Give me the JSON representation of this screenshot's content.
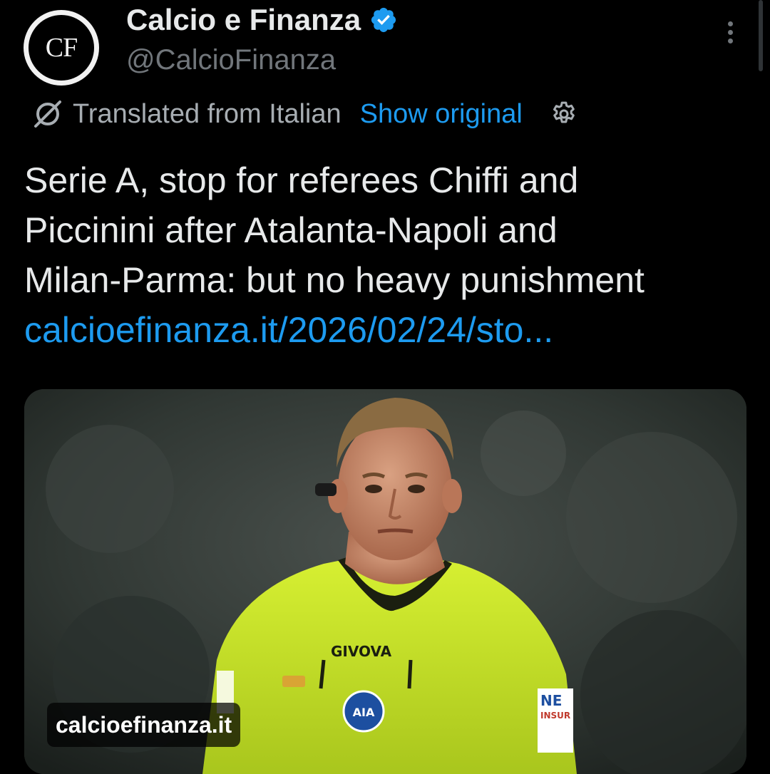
{
  "account": {
    "display_name": "Calcio e Finanza",
    "handle": "@CalcioFinanza",
    "avatar_initials": "CF",
    "verified_icon": "verified-badge-icon"
  },
  "translation": {
    "icon": "translate-icon",
    "label": "Translated from Italian",
    "show_original": "Show original",
    "settings_icon": "gear-icon"
  },
  "post": {
    "text": "Serie A, stop for referees Chiffi and\nPiccinini after Atalanta-Napoli and\nMilan-Parma: but no heavy punishment\n",
    "link": "calcioefinanza.it/2026/02/24/sto..."
  },
  "media": {
    "domain_label": "calcioefinanza.it",
    "shirt_brand": "GIVOVA",
    "badge_text": "AIA",
    "sleeve_text_1": "NE",
    "sleeve_text_2": "INSUR"
  },
  "colors": {
    "background": "#000000",
    "text_primary": "#e7e9ea",
    "text_secondary": "#71767b",
    "link": "#1d9bf0",
    "shirt": "#c8e82b"
  }
}
